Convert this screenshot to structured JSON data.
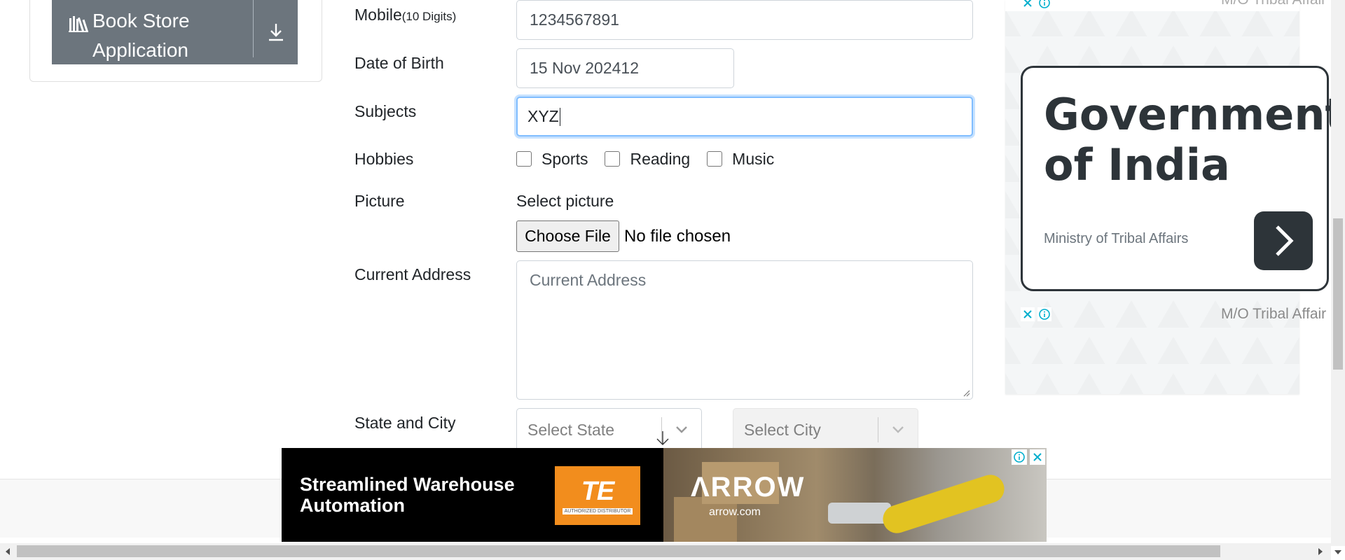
{
  "sidebar": {
    "book_store_line1": "Book Store",
    "book_store_line2": "Application"
  },
  "form": {
    "mobile": {
      "label": "Mobile",
      "hint": "(10 Digits)",
      "value": "1234567891"
    },
    "dob": {
      "label": "Date of Birth",
      "value": "15 Nov 202412"
    },
    "subjects": {
      "label": "Subjects",
      "value": "XYZ"
    },
    "hobbies": {
      "label": "Hobbies",
      "options": [
        {
          "label": "Sports",
          "checked": false
        },
        {
          "label": "Reading",
          "checked": false
        },
        {
          "label": "Music",
          "checked": false
        }
      ]
    },
    "picture": {
      "label": "Picture",
      "select_label": "Select picture",
      "button_label": "Choose File",
      "status": "No file chosen"
    },
    "address": {
      "label": "Current Address",
      "placeholder": "Current Address"
    },
    "state_city": {
      "label": "State and City",
      "state_placeholder": "Select State",
      "city_placeholder": "Select City"
    }
  },
  "ad_right": {
    "title_line1": "Government",
    "title_line2": "of India",
    "subtitle": "Ministry of Tribal Affairs",
    "advertiser": "M/O Tribal Affair",
    "advertiser_top": "M/O Tribal Affair"
  },
  "ad_banner": {
    "headline_line1": "Streamlined Warehouse",
    "headline_line2": "Automation",
    "te_logo": "TE",
    "te_tagline": "AUTHORIZED DISTRIBUTOR",
    "arrow_logo": "ΛRROW",
    "arrow_url": "arrow.com"
  },
  "colors": {
    "focus": "#80bdff",
    "sidebar_button": "#6c757d",
    "ad_dark": "#2d3439",
    "te_orange": "#f28d1d",
    "adchoice_blue": "#00aecd"
  }
}
